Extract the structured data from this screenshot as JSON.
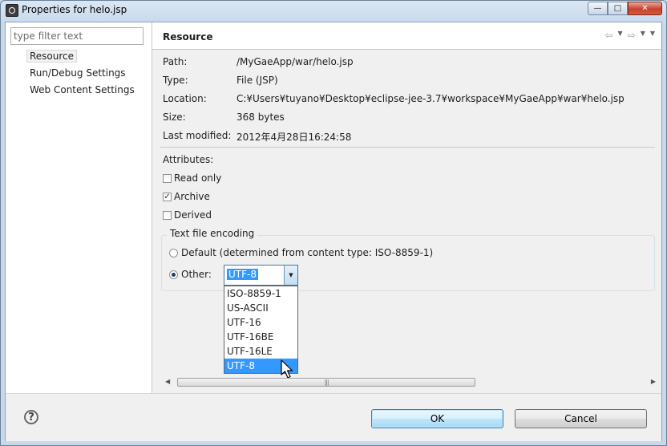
{
  "window": {
    "title": "Properties for helo.jsp",
    "controls": {
      "minimize": "—",
      "maximize": "□",
      "close": "✕"
    }
  },
  "filter": {
    "placeholder": "type filter text"
  },
  "tree": {
    "items": [
      {
        "label": "Resource",
        "selected": true
      },
      {
        "label": "Run/Debug Settings",
        "selected": false
      },
      {
        "label": "Web Content Settings",
        "selected": false
      }
    ]
  },
  "page": {
    "title": "Resource",
    "nav": {
      "back": "⇦",
      "forward": "⇨",
      "menu": "▼"
    }
  },
  "properties": {
    "path_label": "Path:",
    "path_value": "/MyGaeApp/war/helo.jsp",
    "type_label": "Type:",
    "type_value": "File  (JSP)",
    "location_label": "Location:",
    "location_value": "C:¥Users¥tuyano¥Desktop¥eclipse-jee-3.7¥workspace¥MyGaeApp¥war¥helo.jsp",
    "size_label": "Size:",
    "size_value": "368  bytes",
    "modified_label": "Last modified:",
    "modified_value": "2012年4月28日16:24:58"
  },
  "attributes": {
    "label": "Attributes:",
    "read_only": {
      "label": "Read only",
      "checked": false
    },
    "archive": {
      "label": "Archive",
      "checked": true
    },
    "derived": {
      "label": "Derived",
      "checked": false
    }
  },
  "encoding": {
    "legend": "Text file encoding",
    "default_label": "Default (determined from content type: ISO-8859-1)",
    "other_label": "Other:",
    "selected_option": "other",
    "combo_value": "UTF-8",
    "options": [
      "ISO-8859-1",
      "US-ASCII",
      "UTF-16",
      "UTF-16BE",
      "UTF-16LE",
      "UTF-8"
    ],
    "highlighted_option": "UTF-8"
  },
  "buttons": {
    "ok": "OK",
    "cancel": "Cancel",
    "help": "?"
  },
  "colors": {
    "selection": "#3399ff",
    "accent_border": "#3c7fb1"
  }
}
